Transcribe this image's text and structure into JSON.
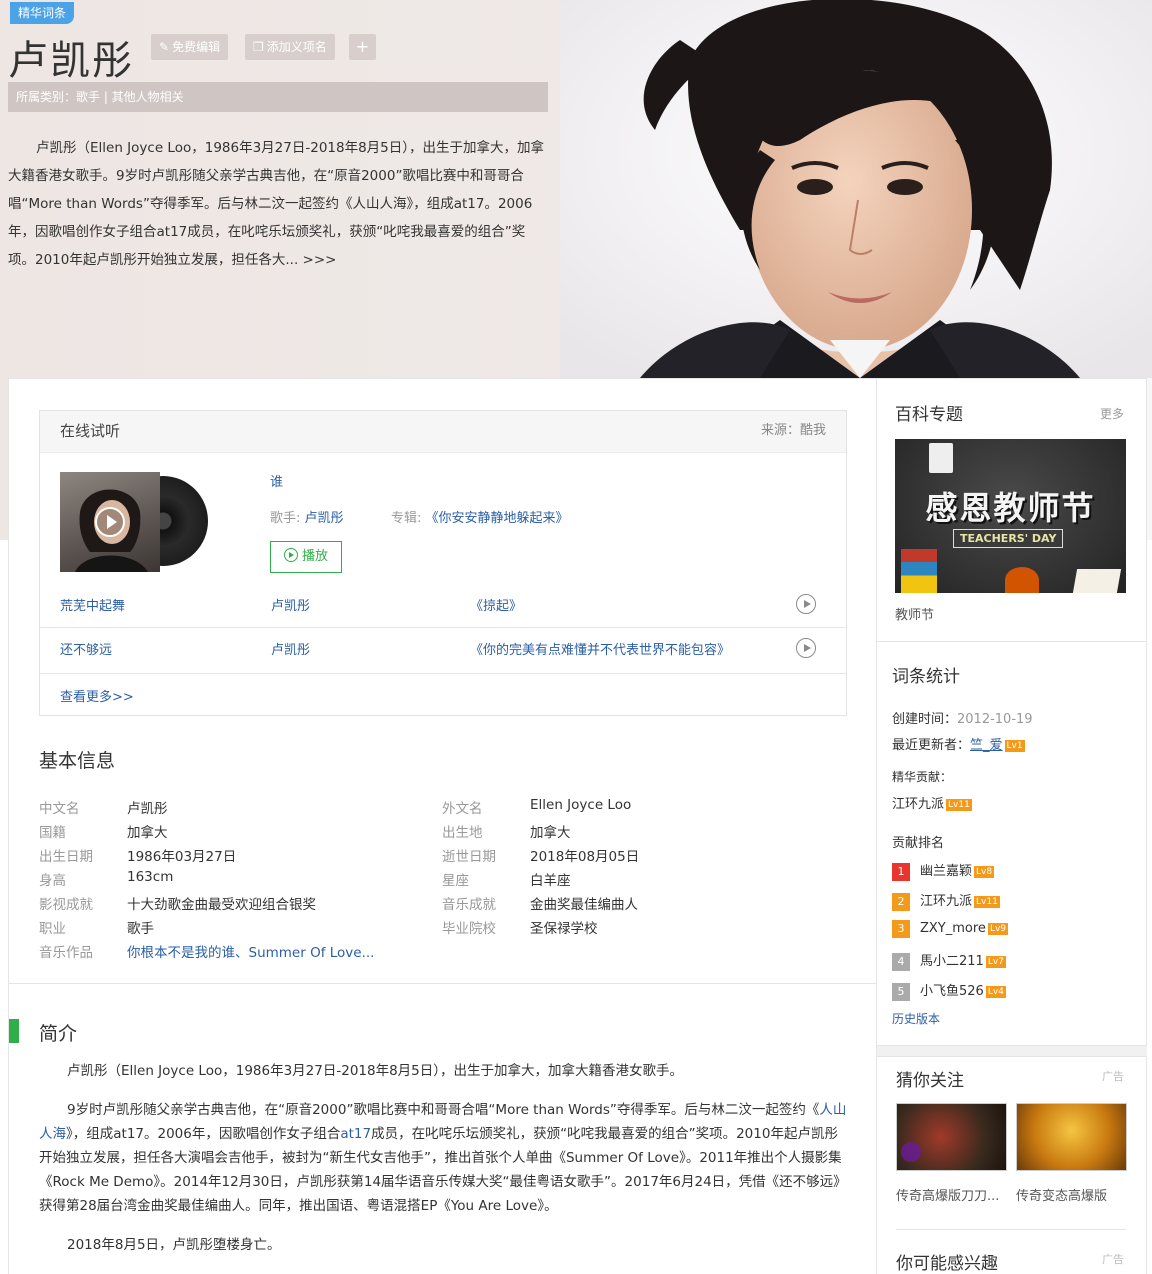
{
  "header": {
    "badge": "精华词条",
    "title": "卢凯彤",
    "edit_label": "免费编辑",
    "add_meaning_label": "添加义项名",
    "add_icon_label": "+",
    "category": "所属类别：歌手 | 其他人物相关",
    "summary": "卢凯彤（Ellen Joyce Loo，1986年3月27日-2018年8月5日），出生于加拿大，加拿大籍香港女歌手。9岁时卢凯彤随父亲学古典吉他，在“原音2000”歌唱比赛中和哥哥合唱“More than Words”夺得季军。后与林二汶一起签约《人山人海》，组成at17。2006年，因歌唱创作女子组合at17成员，在叱咤乐坛颁奖礼，获颁“叱咤我最喜爱的组合”奖项。2010年起卢凯彤开始独立发展，担任各大... >>>"
  },
  "listen": {
    "title": "在线试听",
    "source": "来源：酷我",
    "featured": {
      "song": "谁",
      "singer_label": "歌手:",
      "singer": "卢凯彤",
      "album_label": "专辑:",
      "album": "《你安安静静地躲起来》",
      "play_label": "播放"
    },
    "tracks": [
      {
        "song": "荒芜中起舞",
        "singer": "卢凯彤",
        "album": "《掠起》"
      },
      {
        "song": "还不够远",
        "singer": "卢凯彤",
        "album": "《你的完美有点难懂并不代表世界不能包容》"
      }
    ],
    "more": "查看更多>>"
  },
  "basic_info": {
    "title": "基本信息",
    "left": [
      {
        "label": "中文名",
        "value": "卢凯彤"
      },
      {
        "label": "国籍",
        "value": "加拿大"
      },
      {
        "label": "出生日期",
        "value": "1986年03月27日"
      },
      {
        "label": "身高",
        "value": "163cm"
      },
      {
        "label": "影视成就",
        "value": "十大劲歌金曲最受欢迎组合银奖"
      },
      {
        "label": "职业",
        "value": "歌手"
      },
      {
        "label": "音乐作品",
        "value": "你根本不是我的谁、Summer Of Love..."
      }
    ],
    "right": [
      {
        "label": "外文名",
        "value": "Ellen Joyce Loo"
      },
      {
        "label": "出生地",
        "value": "加拿大"
      },
      {
        "label": "逝世日期",
        "value": "2018年08月05日"
      },
      {
        "label": "星座",
        "value": "白羊座"
      },
      {
        "label": "音乐成就",
        "value": "金曲奖最佳编曲人"
      },
      {
        "label": "毕业院校",
        "value": "圣保禄学校"
      }
    ]
  },
  "intro": {
    "title": "简介",
    "p1": "卢凯彤（Ellen Joyce Loo，1986年3月27日-2018年8月5日），出生于加拿大，加拿大籍香港女歌手。",
    "p2_a": "9岁时卢凯彤随父亲学古典吉他，在“原音2000”歌唱比赛中和哥哥合唱“More than Words”夺得季军。后与林二汶一起签约《",
    "p2_link1": "人山人海",
    "p2_b": "》，组成at17。2006年，因歌唱创作女子组合",
    "p2_link2": "at17",
    "p2_c": "成员，在叱咤乐坛颁奖礼，获颁“叱咤我最喜爱的组合”奖项。2010年起卢凯彤开始独立发展，担任各大演唱会吉他手，被封为“新生代女吉他手”，推出首张个人单曲《Summer Of Love》。2011年推出个人摄影集《Rock Me Demo》。2014年12月30日，卢凯彤获第14届华语音乐传媒大奖“最佳粤语女歌手”。2017年6月24日，凭借《还不够远》获得第28届台湾金曲奖最佳编曲人。同年，推出国语、粤语混搭EP《You Are Love》。",
    "p3": "2018年8月5日，卢凯彤堕楼身亡。"
  },
  "sidebar": {
    "topic": {
      "title": "百科专题",
      "more": "更多",
      "banner_text": "感恩教师节",
      "banner_sub": "TEACHERS' DAY",
      "caption": "教师节"
    },
    "stats": {
      "title": "词条统计",
      "created_label": "创建时间：",
      "created": "2012-10-19",
      "updated_label": "最近更新者：",
      "updater": "竺_爱",
      "updater_lv": "Lv1",
      "essence_label": "精华贡献：",
      "essence_user": "江环九派",
      "essence_lv": "Lv11",
      "rank_label": "贡献排名",
      "ranks": [
        {
          "n": "1",
          "name": "幽兰嘉颖",
          "lv": "Lv8",
          "color": "#e8352f"
        },
        {
          "n": "2",
          "name": "江环九派",
          "lv": "Lv11",
          "color": "#f39a1b"
        },
        {
          "n": "3",
          "name": "ZXY_more",
          "lv": "Lv9",
          "color": "#f39a1b"
        },
        {
          "n": "4",
          "name": "馬小二211",
          "lv": "Lv7",
          "color": "#aaaaaa"
        },
        {
          "n": "5",
          "name": "小飞鱼526",
          "lv": "Lv4",
          "color": "#aaaaaa"
        }
      ],
      "history": "历史版本"
    },
    "guess": {
      "title": "猜你关注",
      "ad": "广告",
      "items": [
        "传奇高爆版刀刀...",
        "传奇变态高爆版"
      ]
    },
    "maybe": {
      "title": "你可能感兴趣",
      "ad": "广告"
    }
  }
}
